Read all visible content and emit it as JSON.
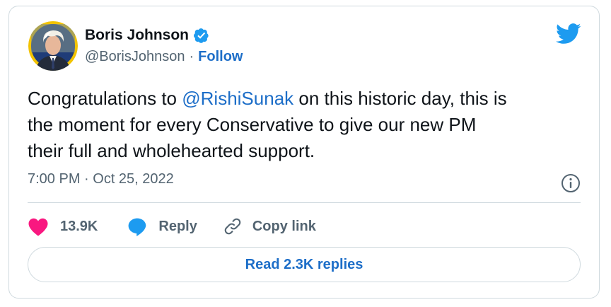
{
  "author": {
    "display_name": "Boris Johnson",
    "handle": "@BorisJohnson",
    "separator": "·",
    "follow_label": "Follow",
    "verified": true
  },
  "tweet": {
    "text_before": "Congratulations to ",
    "mention": "@RishiSunak",
    "text_after": " on this historic day, this is\nthe moment for every Conservative to give our new PM\ntheir full and wholehearted support.",
    "timestamp": "7:00 PM · Oct 25, 2022"
  },
  "actions": {
    "like_count": "13.9K",
    "reply_label": "Reply",
    "copy_link_label": "Copy link"
  },
  "read_replies_label": "Read 2.3K replies",
  "icons": {
    "logo": "twitter-bird-icon",
    "verified": "verified-badge-icon",
    "info": "info-icon",
    "like": "heart-icon",
    "reply": "reply-bubble-icon",
    "copy": "link-icon"
  },
  "colors": {
    "twitter_blue": "#1d9bf0",
    "link_blue": "#1d6ec8",
    "like_pink": "#f91880",
    "secondary_text": "#536471",
    "border": "#cfd9de"
  }
}
